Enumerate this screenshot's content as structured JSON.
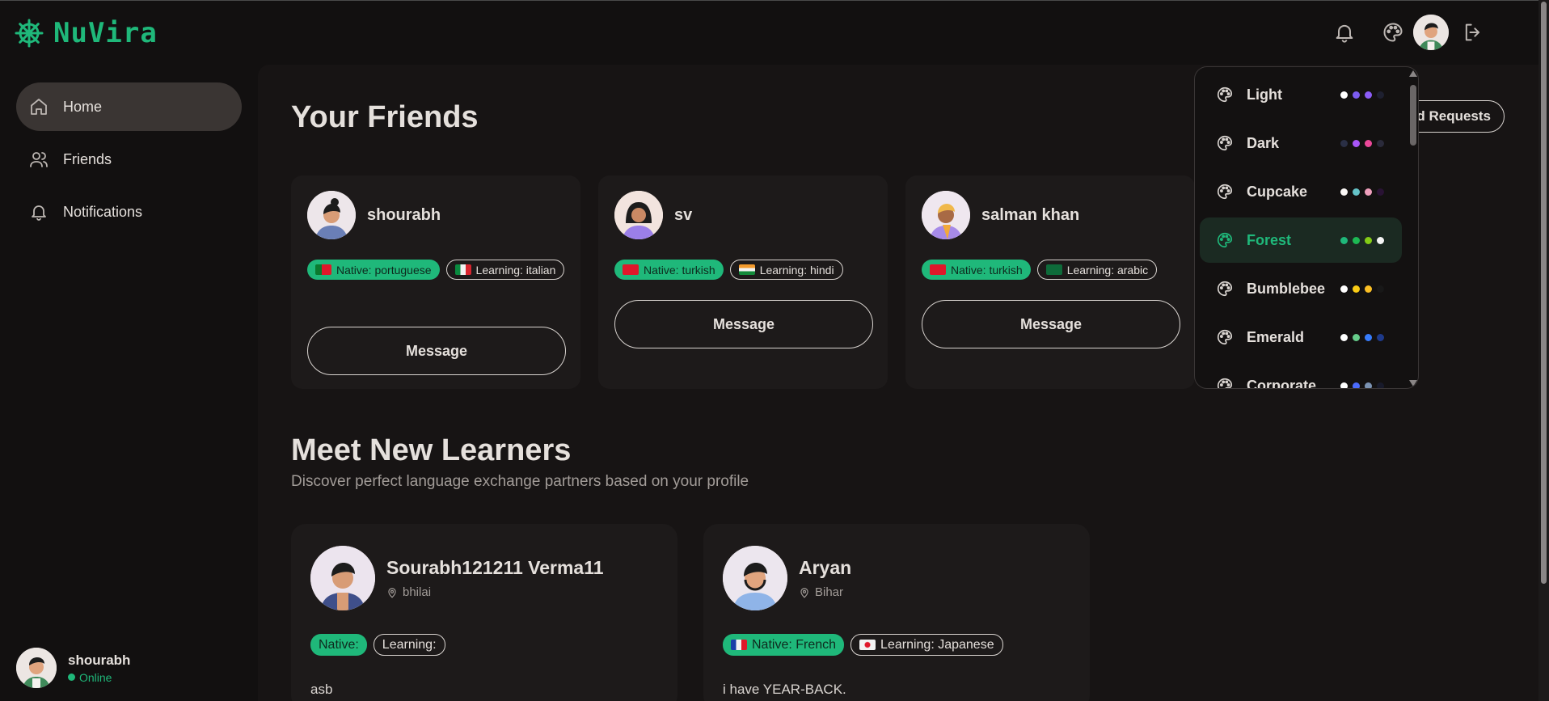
{
  "app": {
    "name": "NuVira"
  },
  "sidebar": {
    "items": [
      {
        "label": "Home",
        "icon": "home-icon",
        "active": true
      },
      {
        "label": "Friends",
        "icon": "users-icon",
        "active": false
      },
      {
        "label": "Notifications",
        "icon": "bell-icon",
        "active": false
      }
    ],
    "user": {
      "name": "shourabh",
      "status": "Online"
    }
  },
  "header": {
    "icons": [
      "bell-icon",
      "palette-icon",
      "avatar",
      "logout-icon"
    ],
    "friend_requests_label": "nd Requests"
  },
  "friends_section": {
    "title": "Your Friends",
    "cards": [
      {
        "name": "shourabh",
        "native": "Native: portuguese",
        "learning": "Learning: italian",
        "button": "Message"
      },
      {
        "name": "sv",
        "native": "Native: turkish",
        "learning": "Learning: hindi",
        "button": "Message"
      },
      {
        "name": "salman khan",
        "native": "Native: turkish",
        "learning": "Learning: arabic",
        "button": "Message"
      }
    ]
  },
  "learners_section": {
    "title": "Meet New Learners",
    "subtitle": "Discover perfect language exchange partners based on your profile",
    "cards": [
      {
        "name": "Sourabh121211 Verma11",
        "location": "bhilai",
        "native": "Native:",
        "learning": "Learning:",
        "bio": "asb"
      },
      {
        "name": "Aryan",
        "location": "Bihar",
        "native": "Native: French",
        "learning": "Learning: Japanese",
        "bio": "i have YEAR-BACK."
      }
    ]
  },
  "theme_menu": {
    "items": [
      {
        "label": "Light",
        "colors": [
          "#ffffff",
          "#7c5cf0",
          "#8b5cf6",
          "#1e2030"
        ],
        "active": false
      },
      {
        "label": "Dark",
        "colors": [
          "#2a2f45",
          "#a855f7",
          "#ec4899",
          "#2a2a3a"
        ],
        "active": false
      },
      {
        "label": "Cupcake",
        "colors": [
          "#faf7f5",
          "#65c3c8",
          "#ef9fbc",
          "#291334"
        ],
        "active": false
      },
      {
        "label": "Forest",
        "colors": [
          "#1fb87a",
          "#1db954",
          "#84cc16",
          "#f5f5f5"
        ],
        "active": true
      },
      {
        "label": "Bumblebee",
        "colors": [
          "#ffffff",
          "#facc15",
          "#fbbf24",
          "#181818"
        ],
        "active": false
      },
      {
        "label": "Emerald",
        "colors": [
          "#ffffff",
          "#66cc8a",
          "#377cfb",
          "#1e3a8a"
        ],
        "active": false
      },
      {
        "label": "Corporate",
        "colors": [
          "#ffffff",
          "#4b6bfb",
          "#7b92b2",
          "#181a2a"
        ],
        "active": false
      }
    ]
  },
  "colors": {
    "accent": "#1fb87a",
    "background": "#121010",
    "card": "#1d1a1a"
  }
}
